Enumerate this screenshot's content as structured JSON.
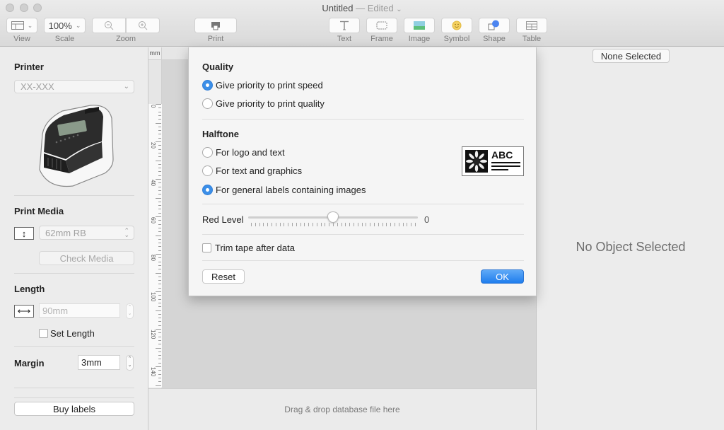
{
  "window": {
    "title": "Untitled",
    "title_separator": " — ",
    "status": "Edited",
    "status_chevron": "⌄"
  },
  "toolbar": {
    "view": {
      "label": "View",
      "icon": "sidebar-layout-icon"
    },
    "scale": {
      "label": "Scale",
      "value": "100%"
    },
    "zoom": {
      "label": "Zoom",
      "out_icon": "zoom-out-icon",
      "in_icon": "zoom-in-icon"
    },
    "print": {
      "label": "Print",
      "icon": "printer-icon"
    },
    "insert": [
      {
        "label": "Text",
        "icon": "text-T-icon"
      },
      {
        "label": "Frame",
        "icon": "frame-icon"
      },
      {
        "label": "Image",
        "icon": "image-icon"
      },
      {
        "label": "Symbol",
        "icon": "smiley-icon"
      },
      {
        "label": "Shape",
        "icon": "shape-icon"
      },
      {
        "label": "Table",
        "icon": "table-icon"
      }
    ],
    "colors": {
      "image_green": "#5cbf7a",
      "image_sky": "#8fcfe0",
      "symbol_yellow": "#f4d060",
      "shape_blue": "#4d85f0"
    }
  },
  "sidebar": {
    "printer": {
      "heading": "Printer",
      "selected": "XX-XXX",
      "image": "label-printer-illustration"
    },
    "print_media": {
      "heading": "Print Media",
      "selected": "62mm RB",
      "check_button": "Check Media",
      "icon": "vertical-size-icon"
    },
    "length": {
      "heading": "Length",
      "value": "90mm",
      "set_length_label": "Set Length",
      "set_length_checked": false,
      "icon": "horizontal-size-icon"
    },
    "margin": {
      "heading": "Margin",
      "value": "3mm"
    },
    "buy_button": "Buy labels"
  },
  "canvas": {
    "ruler_unit": "mm",
    "ruler_labels": [
      "0",
      "20",
      "40",
      "60",
      "80",
      "100",
      "120",
      "140"
    ],
    "dropzone_text": "Drag & drop database file here"
  },
  "right_panel": {
    "selection_button": "None Selected",
    "empty_text": "No Object Selected"
  },
  "dialog": {
    "quality": {
      "heading": "Quality",
      "options": [
        {
          "label": "Give priority to print speed",
          "selected": true
        },
        {
          "label": "Give priority to print quality",
          "selected": false
        }
      ]
    },
    "halftone": {
      "heading": "Halftone",
      "options": [
        {
          "label": "For logo and text",
          "selected": false
        },
        {
          "label": "For text and graphics",
          "selected": false
        },
        {
          "label": "For general labels containing images",
          "selected": true
        }
      ],
      "preview_text": "ABC"
    },
    "red_level": {
      "label": "Red Level",
      "value": "0",
      "position_fraction": 0.5
    },
    "trim_tape": {
      "label": "Trim tape after data",
      "checked": false
    },
    "reset_button": "Reset",
    "ok_button": "OK",
    "accent_color": "#2f82ea"
  }
}
